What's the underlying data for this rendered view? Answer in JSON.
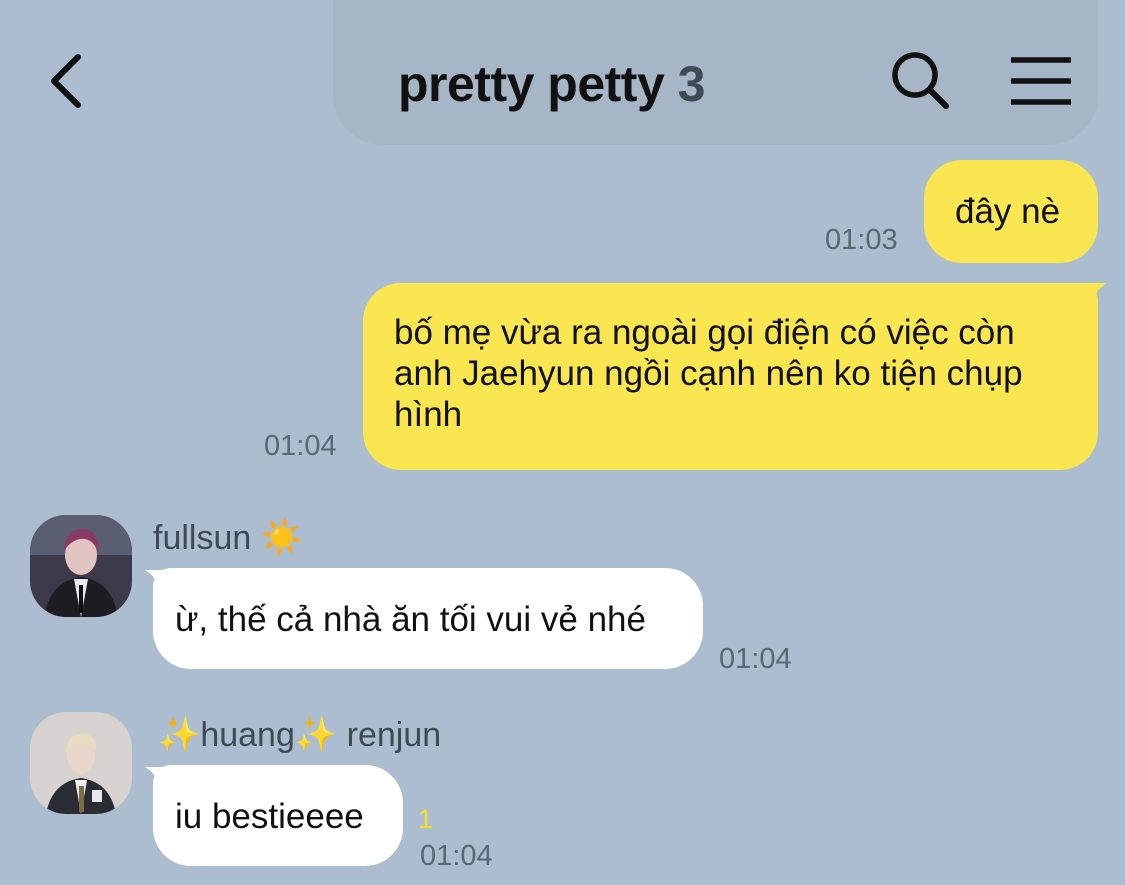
{
  "header": {
    "title": "pretty petty",
    "member_count": "3",
    "back_icon": "chevron-left-icon",
    "search_icon": "search-icon",
    "menu_icon": "hamburger-menu-icon"
  },
  "messages": [
    {
      "sender": "me",
      "text": "đây nè",
      "time": "01:03"
    },
    {
      "sender": "me",
      "text": "bố mẹ vừa ra ngoài gọi điện có việc còn anh Jaehyun ngồi cạnh nên ko tiện chụp hình",
      "time": "01:04"
    },
    {
      "sender_name": "fullsun ☀️",
      "text": "ừ, thế cả nhà ăn tối vui vẻ nhé",
      "time": "01:04"
    },
    {
      "sender_name": "✨huang✨ renjun",
      "text": "iu bestieeee",
      "time": "01:04",
      "unread": "1"
    }
  ],
  "colors": {
    "background": "#abbdcf",
    "my_bubble": "#f9e650",
    "other_bubble": "#ffffff",
    "unread": "#f4df2a"
  }
}
